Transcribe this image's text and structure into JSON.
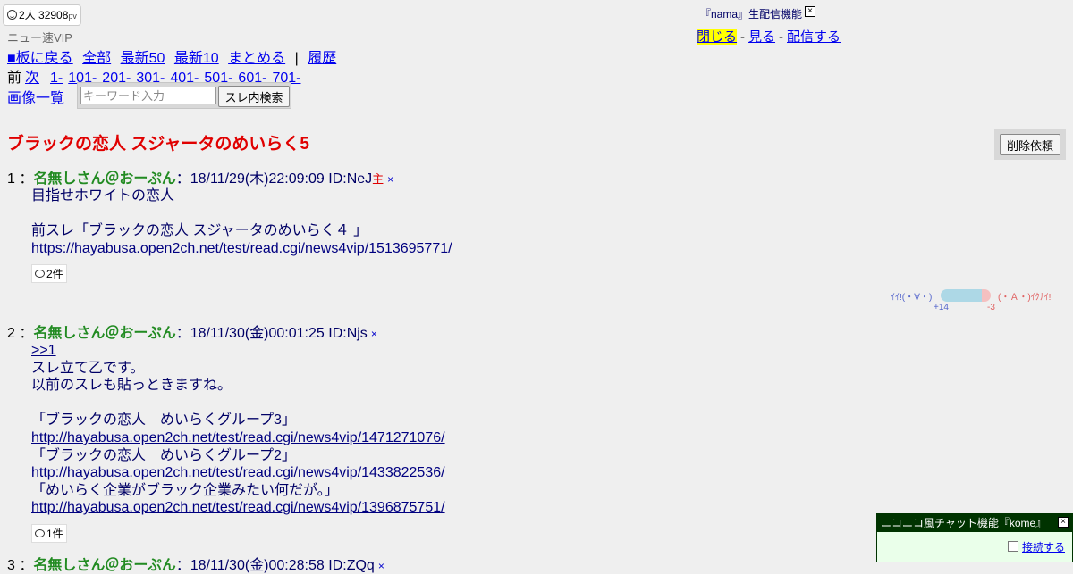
{
  "counter": {
    "viewers": "2人",
    "pageviews": "32908",
    "pv_unit": "pv",
    "icon": "smiley-icon"
  },
  "board": {
    "name": "ニュー速VIP"
  },
  "nav": {
    "back": "■板に戻る",
    "all": "全部",
    "latest50": "最新50",
    "latest10": "最新10",
    "summary": "まとめる",
    "separator": "|",
    "history": "履歴",
    "prev": "前",
    "next": "次",
    "ranges": [
      "1-",
      "101-",
      "201-",
      "301-",
      "401-",
      "501-",
      "601-",
      "701-"
    ],
    "images": "画像一覧"
  },
  "search": {
    "placeholder": "キーワード入力",
    "button": "スレ内検索"
  },
  "nama": {
    "title": "『nama』生配信機能",
    "close": "×",
    "close_link": "閉じる",
    "view_link": "見る",
    "broadcast_link": "配信する",
    "separator": "-"
  },
  "thread": {
    "title": "ブラックの恋人 スジャータのめいらく5",
    "delete_button": "削除依頼"
  },
  "posts": [
    {
      "number": "1",
      "sep": "：",
      "name": "名無しさん＠おーぷん",
      "date": "：18/11/29(木)22:09:09",
      "id": "ID:NeJ",
      "owner": "主",
      "x": "×",
      "lines": [
        "目指せホワイトの恋人",
        "前スレ「ブラックの恋人 スジャータのめいらく４ 」",
        "https://hayabusa.open2ch.net/test/read.cgi/news4vip/1513695771/"
      ],
      "replies": "2件"
    },
    {
      "number": "2",
      "sep": "：",
      "name": "名無しさん＠おーぷん",
      "date": "：18/11/30(金)00:01:25",
      "id": "ID:Njs",
      "x": "×",
      "lines": [
        ">>1",
        "スレ立て乙です。",
        "以前のスレも貼っときますね。",
        "「ブラックの恋人　めいらくグループ3」",
        "http://hayabusa.open2ch.net/test/read.cgi/news4vip/1471271076/",
        "「ブラックの恋人　めいらくグループ2」",
        "http://hayabusa.open2ch.net/test/read.cgi/news4vip/1433822536/",
        "「めいらく企業がブラック企業みたい何だが。」",
        "http://hayabusa.open2ch.net/test/read.cgi/news4vip/1396875751/"
      ],
      "replies": "1件"
    },
    {
      "number": "3",
      "sep": "：",
      "name": "名無しさん＠おーぷん",
      "date": "：18/11/30(金)00:28:58",
      "id": "ID:ZQq",
      "x": "×"
    }
  ],
  "vote": {
    "good_label": "ｲｲ!(・∀・)",
    "bad_label": "(・Ａ・)ｲｸﾅｲ!",
    "good_count": "+14",
    "bad_count": "-3",
    "good": 14,
    "bad": 3
  },
  "chat": {
    "title": "ニコニコ風チャット機能『kome』",
    "close": "×",
    "connect": "接続する"
  }
}
